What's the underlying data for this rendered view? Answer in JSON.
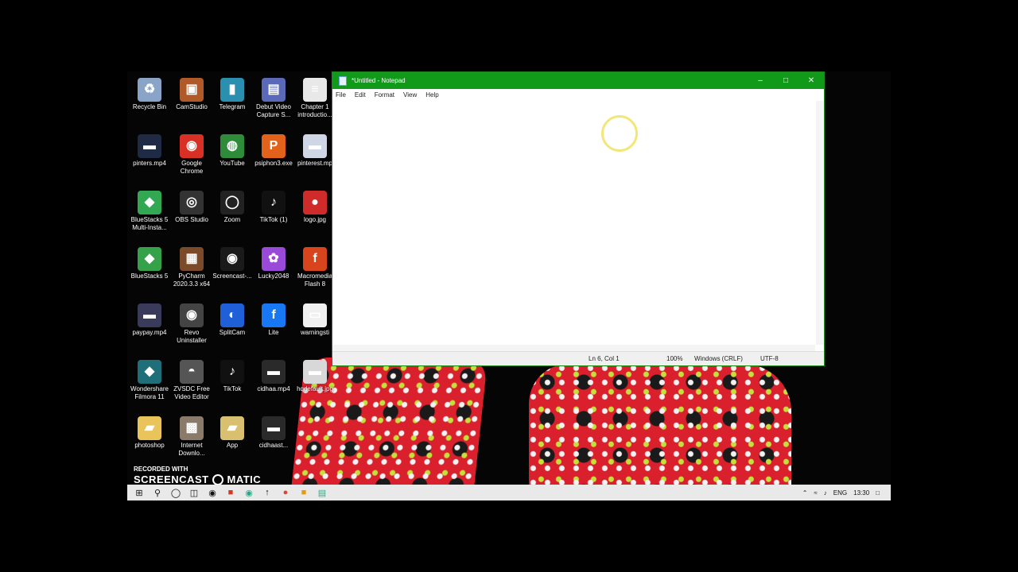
{
  "desktop": {
    "icons": [
      {
        "label": "Recycle Bin",
        "glyph": "♻",
        "color": "#8aa4c8"
      },
      {
        "label": "CamStudio",
        "glyph": "▣",
        "color": "#b05a2a"
      },
      {
        "label": "Telegram",
        "glyph": "▮",
        "color": "#2b8fb0"
      },
      {
        "label": "Debut Video Capture S...",
        "glyph": "▤",
        "color": "#5a6ab8"
      },
      {
        "label": "Chapter 1 introductio...",
        "glyph": "≡",
        "color": "#e8e8e8"
      },
      {
        "label": "pinters.mp4",
        "glyph": "▬",
        "color": "#1f2a44"
      },
      {
        "label": "Google Chrome",
        "glyph": "◉",
        "color": "#d93025"
      },
      {
        "label": "YouTube",
        "glyph": "◍",
        "color": "#2e8b3a"
      },
      {
        "label": "psiphon3.exe",
        "glyph": "P",
        "color": "#e2621b"
      },
      {
        "label": "pinterest.mp",
        "glyph": "▬",
        "color": "#cfd6e6"
      },
      {
        "label": "BlueStacks 5 Multi-Insta...",
        "glyph": "◆",
        "color": "#33a852"
      },
      {
        "label": "OBS Studio",
        "glyph": "◎",
        "color": "#333333"
      },
      {
        "label": "Zoom",
        "glyph": "◯",
        "color": "#222222"
      },
      {
        "label": "TikTok (1)",
        "glyph": "♪",
        "color": "#111111"
      },
      {
        "label": "logo.jpg",
        "glyph": "●",
        "color": "#cf2b2b"
      },
      {
        "label": "BlueStacks 5",
        "glyph": "◆",
        "color": "#35a24a"
      },
      {
        "label": "PyCharm 2020.3.3 x64",
        "glyph": "▦",
        "color": "#7a4a2a"
      },
      {
        "label": "Screencast-...",
        "glyph": "◉",
        "color": "#1a1a1a"
      },
      {
        "label": "Lucky2048",
        "glyph": "✿",
        "color": "#9a4ad8"
      },
      {
        "label": "Macromedia Flash 8",
        "glyph": "f",
        "color": "#d8441c"
      },
      {
        "label": "paypay.mp4",
        "glyph": "▬",
        "color": "#3a3a5a"
      },
      {
        "label": "Revo Uninstaller",
        "glyph": "◉",
        "color": "#444444"
      },
      {
        "label": "SplitCam",
        "glyph": "◐",
        "color": "#1f5fd8"
      },
      {
        "label": "Lite",
        "glyph": "f",
        "color": "#1877f2"
      },
      {
        "label": "warningsti",
        "glyph": "▭",
        "color": "#f0f0f0"
      },
      {
        "label": "Wondershare Filmora 11",
        "glyph": "◆",
        "color": "#1f6f7a"
      },
      {
        "label": "ZVSDC Free Video Editor",
        "glyph": "◓",
        "color": "#555555"
      },
      {
        "label": "TikTok",
        "glyph": "♪",
        "color": "#111111"
      },
      {
        "label": "cidhaa.mp4",
        "glyph": "▬",
        "color": "#2a2a2a"
      },
      {
        "label": "hqdefault.jpg",
        "glyph": "▬",
        "color": "#d8d8d8"
      },
      {
        "label": "photoshop",
        "glyph": "▰",
        "color": "#e8c45a"
      },
      {
        "label": "Internet Downlo...",
        "glyph": "▩",
        "color": "#8a7a6a"
      },
      {
        "label": "App",
        "glyph": "▰",
        "color": "#d8c070"
      },
      {
        "label": "cidhaast...",
        "glyph": "▬",
        "color": "#2a2a2a"
      }
    ]
  },
  "notepad": {
    "title": "*Untitled - Notepad",
    "menu": [
      "File",
      "Edit",
      "Format",
      "View",
      "Help"
    ],
    "content": "",
    "status": {
      "position": "Ln 6, Col 1",
      "zoom": "100%",
      "line_ending": "Windows (CRLF)",
      "encoding": "UTF-8"
    },
    "colors": {
      "titlebar": "#119a1a"
    }
  },
  "watermark": {
    "line1": "RECORDED WITH",
    "line2a": "SCREENCAST",
    "line2b": "MATIC"
  },
  "taskbar": {
    "apps": [
      "start",
      "search",
      "cortana",
      "task-view",
      "screencast",
      "chrome",
      "usb",
      "flash",
      "app",
      "notepad"
    ],
    "tray": {
      "lang": "ENG",
      "time": "13:30"
    }
  }
}
